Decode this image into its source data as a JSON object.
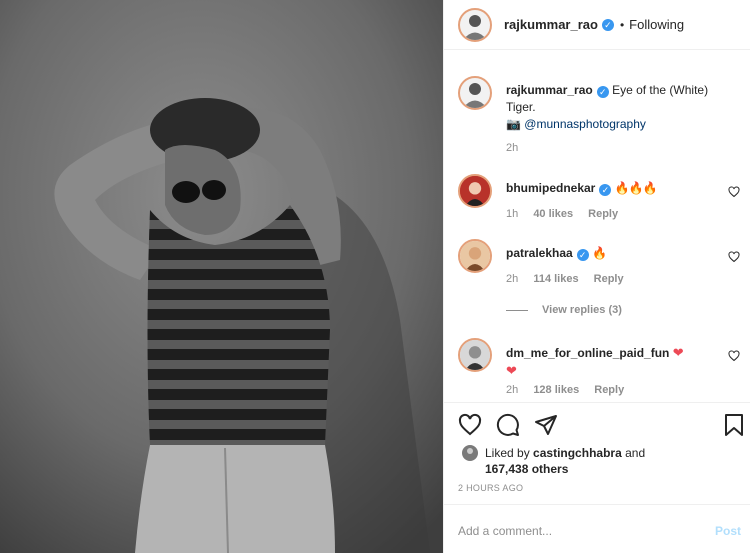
{
  "post": {
    "username": "rajkummar_rao",
    "verified_icon": "verified-badge-icon",
    "dot": "•",
    "follow_status": "Following",
    "caption_part1": "Eye of the (White)",
    "caption_part2": "Tiger.",
    "camera_icon": "camera-emoji-icon",
    "credit_link": "@munnasphotography",
    "caption_time": "2h",
    "photo_icon": "person-photo"
  },
  "comments": [
    {
      "username": "bhumipednekar",
      "text": "🔥🔥🔥",
      "time": "1h",
      "likes": "40 likes",
      "reply": "Reply"
    },
    {
      "username": "patralekhaa",
      "text": "🔥",
      "time": "2h",
      "likes": "114 likes",
      "reply": "Reply"
    },
    {
      "username": "dm_me_for_online_paid_fun",
      "text_a": "❤",
      "text_b": "❤",
      "time": "2h",
      "likes": "128 likes",
      "reply": "Reply"
    }
  ],
  "view_replies": "View replies (3)",
  "liked_by": {
    "prefix": "Liked by",
    "user": "castingchhabra",
    "and": "and",
    "count": "167,438 others"
  },
  "timestamp": "2 HOURS AGO",
  "comment_box": {
    "placeholder": "Add a comment...",
    "post_label": "Post"
  },
  "colors": {
    "link": "#003569",
    "verified": "#3897f0",
    "muted": "#8e8e8e",
    "post_disabled": "#b2dffc"
  }
}
